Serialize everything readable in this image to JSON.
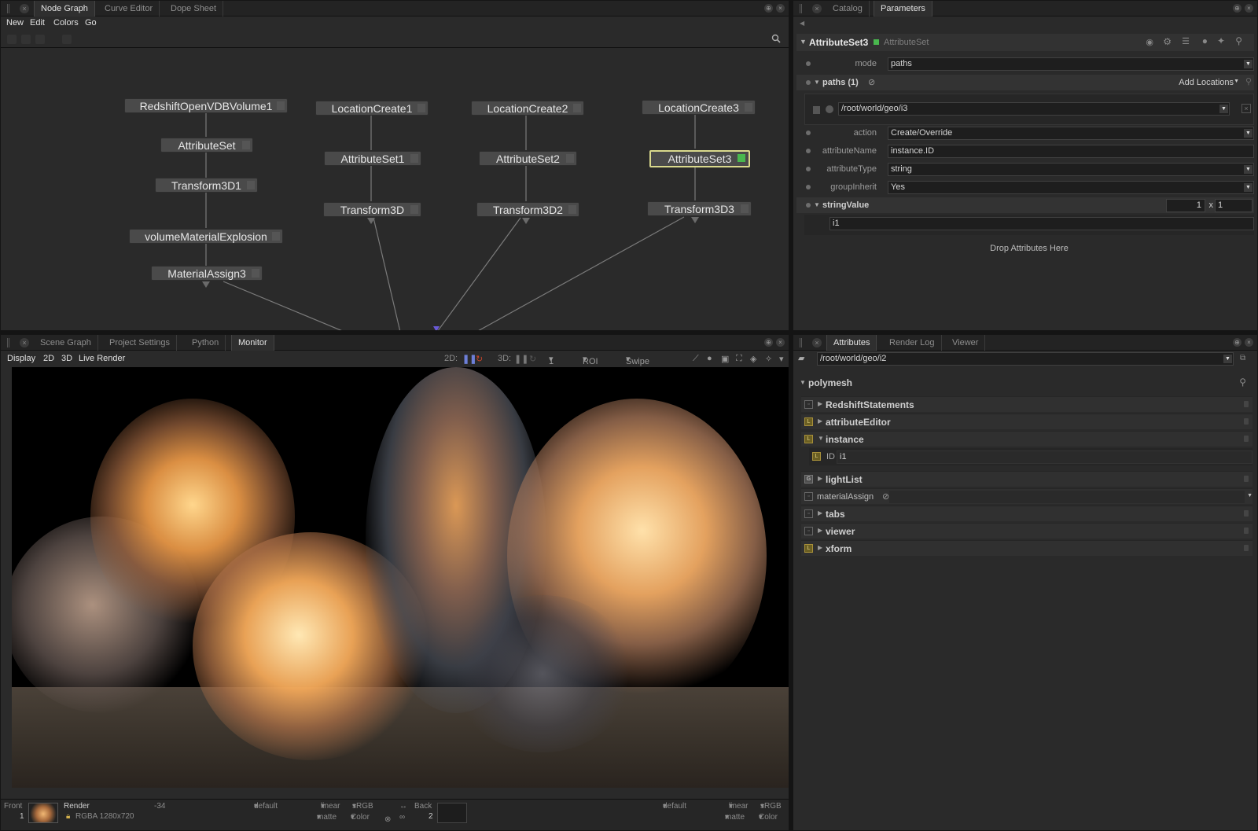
{
  "node_graph_pane": {
    "tabs": [
      "Node Graph",
      "Curve Editor",
      "Dope Sheet"
    ],
    "menu": [
      "New",
      "Edit",
      "Colors",
      "Go"
    ],
    "nodes": {
      "redshift": "RedshiftOpenVDBVolume1",
      "attrset": "AttributeSet",
      "transform1": "Transform3D1",
      "volmat": "volumeMaterialExplosion",
      "matassign": "MaterialAssign3",
      "loc1": "LocationCreate1",
      "attrset1": "AttributeSet1",
      "transform3d": "Transform3D",
      "loc2": "LocationCreate2",
      "attrset2": "AttributeSet2",
      "transform2": "Transform3D2",
      "loc3": "LocationCreate3",
      "attrset3": "AttributeSet3",
      "transform3": "Transform3D3"
    }
  },
  "parameters_pane": {
    "tabs": [
      "Catalog",
      "Parameters"
    ],
    "node_name": "AttributeSet3",
    "node_type": "AttributeSet",
    "mode_label": "mode",
    "mode_value": "paths",
    "paths_label": "paths (1)",
    "add_locations": "Add Locations",
    "path_value": "/root/world/geo/i3",
    "action_label": "action",
    "action_value": "Create/Override",
    "attributeName_label": "attributeName",
    "attributeName_value": "instance.ID",
    "attributeType_label": "attributeType",
    "attributeType_value": "string",
    "groupInherit_label": "groupInherit",
    "groupInherit_value": "Yes",
    "stringValue_label": "stringValue",
    "tuple_a": "1",
    "tuple_x": "x",
    "tuple_b": "1",
    "string_entry": "i1",
    "drop_text": "Drop Attributes Here"
  },
  "monitor_pane": {
    "tabs": [
      "Scene Graph",
      "Project Settings",
      "Python",
      "Monitor"
    ],
    "menu": [
      "Display",
      "2D",
      "3D",
      "Live Render"
    ],
    "toolbar": {
      "twod": "2D:",
      "threed": "3D:",
      "ratio": "1 : 1",
      "roi": "ROI Off",
      "swipe": "Swipe Off"
    },
    "bottom": {
      "front": "Front",
      "front_num": "1",
      "render": "Render",
      "frame": "-34",
      "rgba": "RGBA 1280x720",
      "default_a": "default",
      "linear_a": "linear",
      "srgb_a": "sRGB",
      "matte_a": "matte",
      "color_a": "Color",
      "back": "Back",
      "back_num": "2",
      "default_b": "default",
      "linear_b": "linear",
      "srgb_b": "sRGB",
      "matte_b": "matte",
      "color_b": "Color"
    }
  },
  "attributes_pane": {
    "tabs": [
      "Attributes",
      "Render Log",
      "Viewer"
    ],
    "location": "/root/world/geo/i2",
    "group": "polymesh",
    "items": {
      "redshift": "RedshiftStatements",
      "attreditor": "attributeEditor",
      "instance": "instance",
      "id_label": "ID",
      "id_value": "i1",
      "lightlist": "lightList",
      "matassign": "materialAssign",
      "tabs": "tabs",
      "viewer": "viewer",
      "xform": "xform"
    }
  },
  "colors": {
    "selection_border": "#d9d98c",
    "node_flag": "#49b84e",
    "attr_icon": "#a8903a"
  }
}
